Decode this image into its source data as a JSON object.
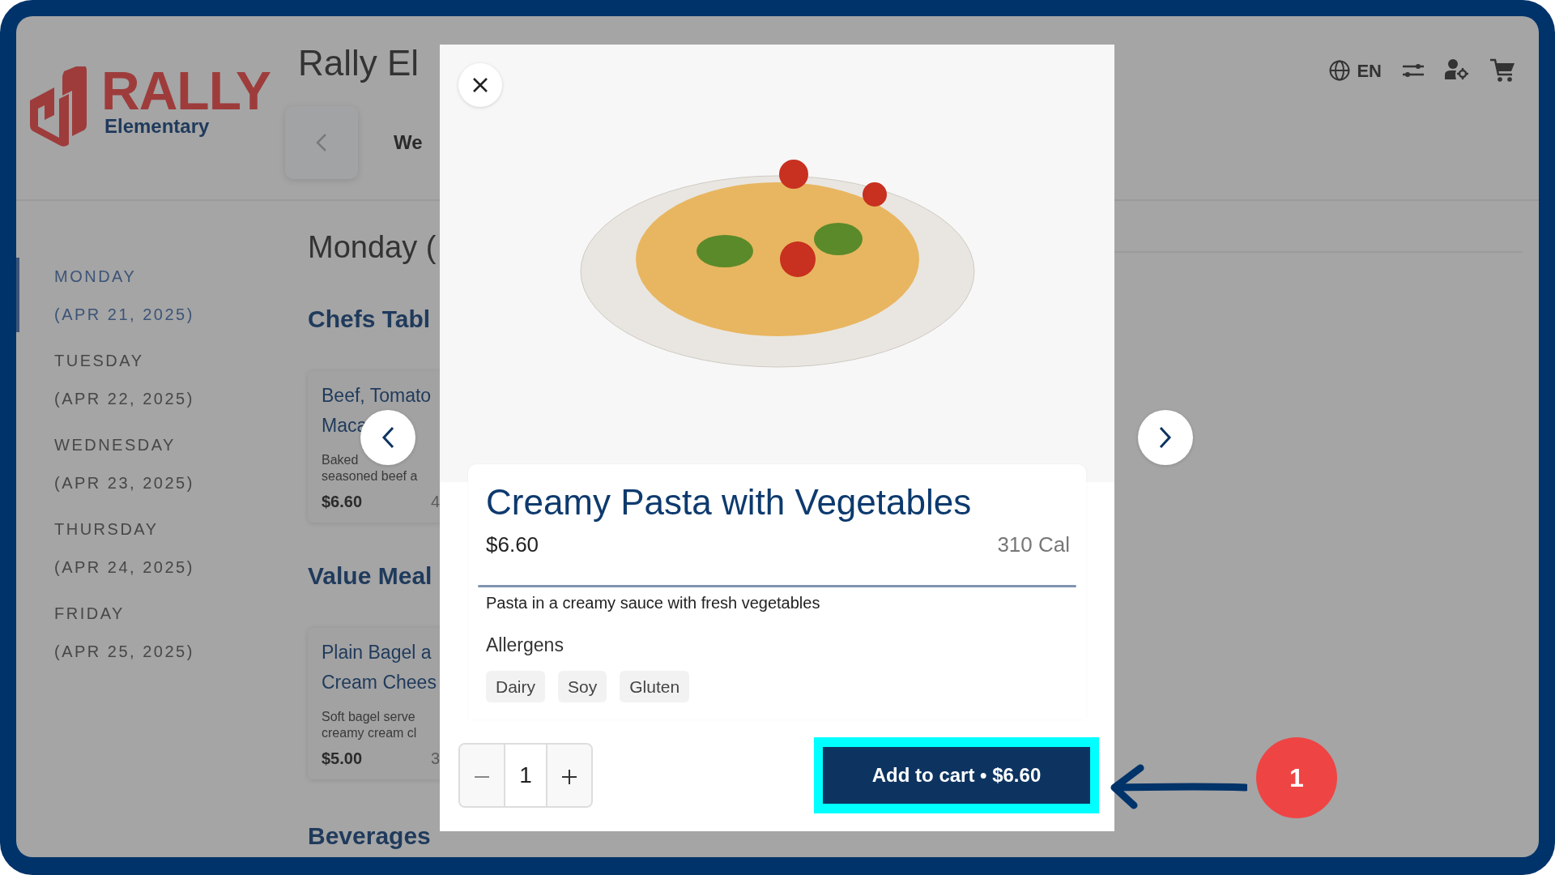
{
  "header": {
    "logo": {
      "wordmark": "RALLY",
      "subtitle": "Elementary"
    },
    "title": "Rally El",
    "week_label": "We",
    "language": "EN"
  },
  "sidebar": {
    "items": [
      {
        "day": "MONDAY",
        "date": "(APR 21, 2025)",
        "selected": true
      },
      {
        "day": "TUESDAY",
        "date": "(APR 22, 2025)",
        "selected": false
      },
      {
        "day": "WEDNESDAY",
        "date": "(APR 23, 2025)",
        "selected": false
      },
      {
        "day": "THURSDAY",
        "date": "(APR 24, 2025)",
        "selected": false
      },
      {
        "day": "FRIDAY",
        "date": "(APR 25, 2025)",
        "selected": false
      }
    ]
  },
  "main": {
    "heading": "Monday (",
    "sections": [
      {
        "title": "Chefs Tabl",
        "card": {
          "title_lines": [
            "Beef, Tomato",
            "Maca"
          ],
          "description_lines": [
            "Baked",
            "seasoned beef a"
          ],
          "price": "$6.60",
          "calories": "4"
        }
      },
      {
        "title": "Value Meal",
        "card": {
          "title_lines": [
            "Plain Bagel a",
            "Cream Chees"
          ],
          "description_lines": [
            "Soft bagel serve",
            "creamy cream cl"
          ],
          "price": "$5.00",
          "calories": "3"
        }
      },
      {
        "title": "Beverages"
      }
    ]
  },
  "modal": {
    "title": "Creamy Pasta with Vegetables",
    "price": "$6.60",
    "calories": "310 Cal",
    "description": "Pasta in a creamy sauce with fresh vegetables",
    "allergens_label": "Allergens",
    "allergens": [
      "Dairy",
      "Soy",
      "Gluten"
    ],
    "quantity": "1",
    "add_button": {
      "label": "Add to cart • $6.60",
      "highlighted": true
    }
  },
  "annotation": {
    "step": "1"
  }
}
